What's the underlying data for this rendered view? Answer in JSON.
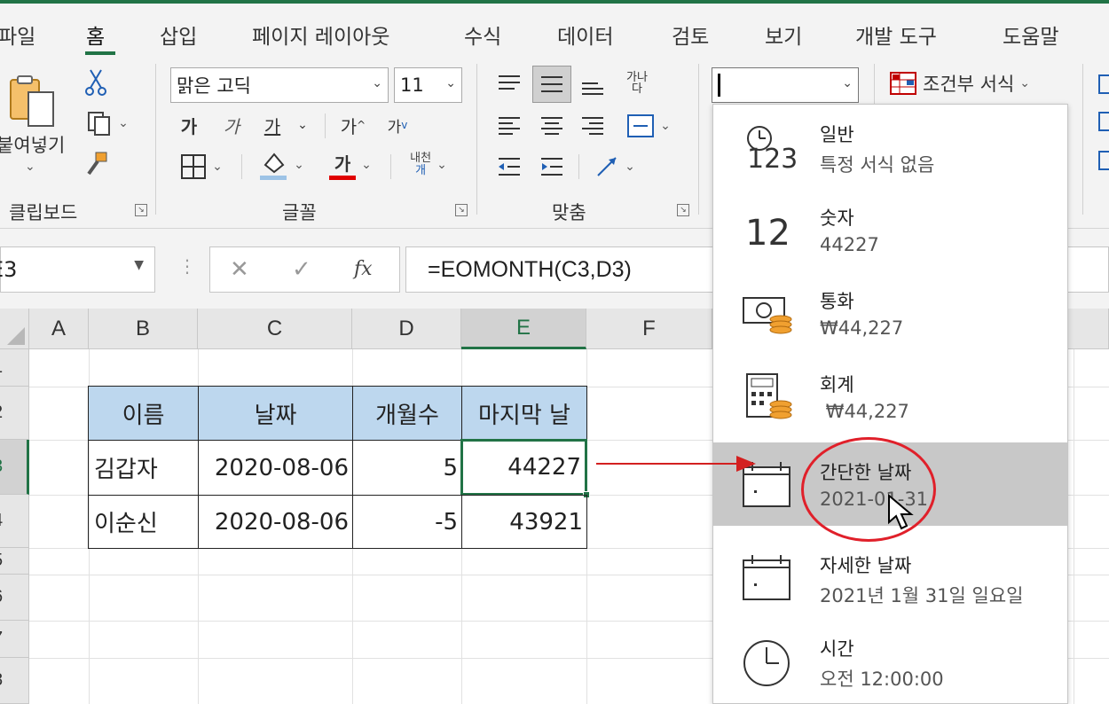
{
  "tabs": [
    "파일",
    "홈",
    "삽입",
    "페이지 레이아웃",
    "수식",
    "데이터",
    "검토",
    "보기",
    "개발 도구",
    "도움말"
  ],
  "ribbon": {
    "paste_label": "붙여넣기",
    "font_name": "맑은 고딕",
    "font_size": "11",
    "bold": "가",
    "italic": "가",
    "underline": "가",
    "grow_font": "가",
    "shrink_font": "가",
    "font_color_glyph": "가",
    "wrap_label_top": "가나",
    "wrap_label_bottom": "다",
    "phonetic_top": "내천",
    "phonetic_bottom": "개",
    "number_format_value": "",
    "conditional_format": "조건부 서식",
    "groups": {
      "clipboard": "클립보드",
      "font": "글꼴",
      "alignment": "맞춤"
    },
    "colors": {
      "fill_swatch": "#9dc3e6",
      "font_swatch": "#e00000",
      "accent": "#217346"
    }
  },
  "formula_bar": {
    "name_box": "E3",
    "cancel": "✕",
    "enter": "✓",
    "fx": "fx",
    "formula": "=EOMONTH(C3,D3)"
  },
  "grid": {
    "columns": [
      "A",
      "B",
      "C",
      "D",
      "E",
      "F"
    ],
    "rows": [
      "1",
      "2",
      "3",
      "4",
      "5",
      "6",
      "7",
      "8"
    ],
    "headers": [
      "이름",
      "날짜",
      "개월수",
      "마지막 날"
    ],
    "data": [
      [
        "김갑자",
        "2020-08-06",
        "5",
        "44227"
      ],
      [
        "이순신",
        "2020-08-06",
        "-5",
        "43921"
      ]
    ]
  },
  "number_format_menu": {
    "items": [
      {
        "title": "일반",
        "sub": "특정 서식 없음",
        "icon": "clock-123-icon"
      },
      {
        "title": "숫자",
        "sub": "44227",
        "icon": "number-12-icon",
        "glyph": "12"
      },
      {
        "title": "통화",
        "sub": "₩44,227",
        "icon": "currency-icon"
      },
      {
        "title": "회계",
        "sub": " ₩44,227",
        "icon": "accounting-icon"
      },
      {
        "title": "간단한 날짜",
        "sub": "2021-01-31",
        "icon": "calendar-icon"
      },
      {
        "title": "자세한 날짜",
        "sub": "2021년 1월 31일 일요일",
        "icon": "calendar-icon"
      },
      {
        "title": "시간",
        "sub": "오전 12:00:00",
        "icon": "clock-icon"
      }
    ],
    "selected_index": 4,
    "icon_123": "123",
    "highlight_color": "#c8c8c8"
  }
}
